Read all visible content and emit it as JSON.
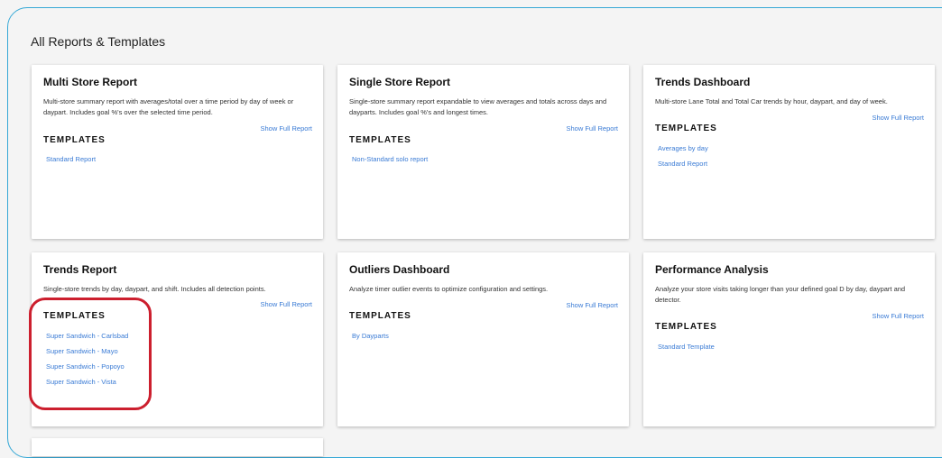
{
  "page": {
    "title": "All Reports & Templates",
    "accent_color": "#35a8d6",
    "link_color": "#3a7bd5",
    "highlight_color": "#cc1f2e"
  },
  "cards": [
    {
      "title": "Multi Store Report",
      "description": "Multi-store summary report with averages/total over a time period by day of week or daypart. Includes goal %'s over the selected time period.",
      "show_full": "Show Full Report",
      "templates_heading": "TEMPLATES",
      "templates": [
        "Standard Report"
      ]
    },
    {
      "title": "Single Store Report",
      "description": "Single-store summary report expandable to view averages and totals across days and dayparts. Includes goal %'s and longest times.",
      "show_full": "Show Full Report",
      "templates_heading": "TEMPLATES",
      "templates": [
        "Non-Standard solo report"
      ]
    },
    {
      "title": "Trends Dashboard",
      "description": "Multi-store Lane Total and Total Car trends by hour, daypart, and day of week.",
      "show_full": "Show Full Report",
      "templates_heading": "TEMPLATES",
      "templates": [
        "Averages by day",
        "Standard Report"
      ]
    },
    {
      "title": "Trends Report",
      "description": "Single-store trends by day, daypart, and shift. Includes all detection points.",
      "show_full": "Show Full Report",
      "templates_heading": "TEMPLATES",
      "templates": [
        "Super Sandwich - Carlsbad",
        "Super Sandwich - Mayo",
        "Super Sandwich - Popoyo",
        "Super Sandwich - Vista"
      ]
    },
    {
      "title": "Outliers Dashboard",
      "description": "Analyze timer outlier events to optimize configuration and settings.",
      "show_full": "Show Full Report",
      "templates_heading": "TEMPLATES",
      "templates": [
        "By Dayparts"
      ]
    },
    {
      "title": "Performance Analysis",
      "description": "Analyze your store visits taking longer than your defined goal D by day, daypart and detector.",
      "show_full": "Show Full Report",
      "templates_heading": "TEMPLATES",
      "templates": [
        "Standard Template"
      ]
    }
  ]
}
